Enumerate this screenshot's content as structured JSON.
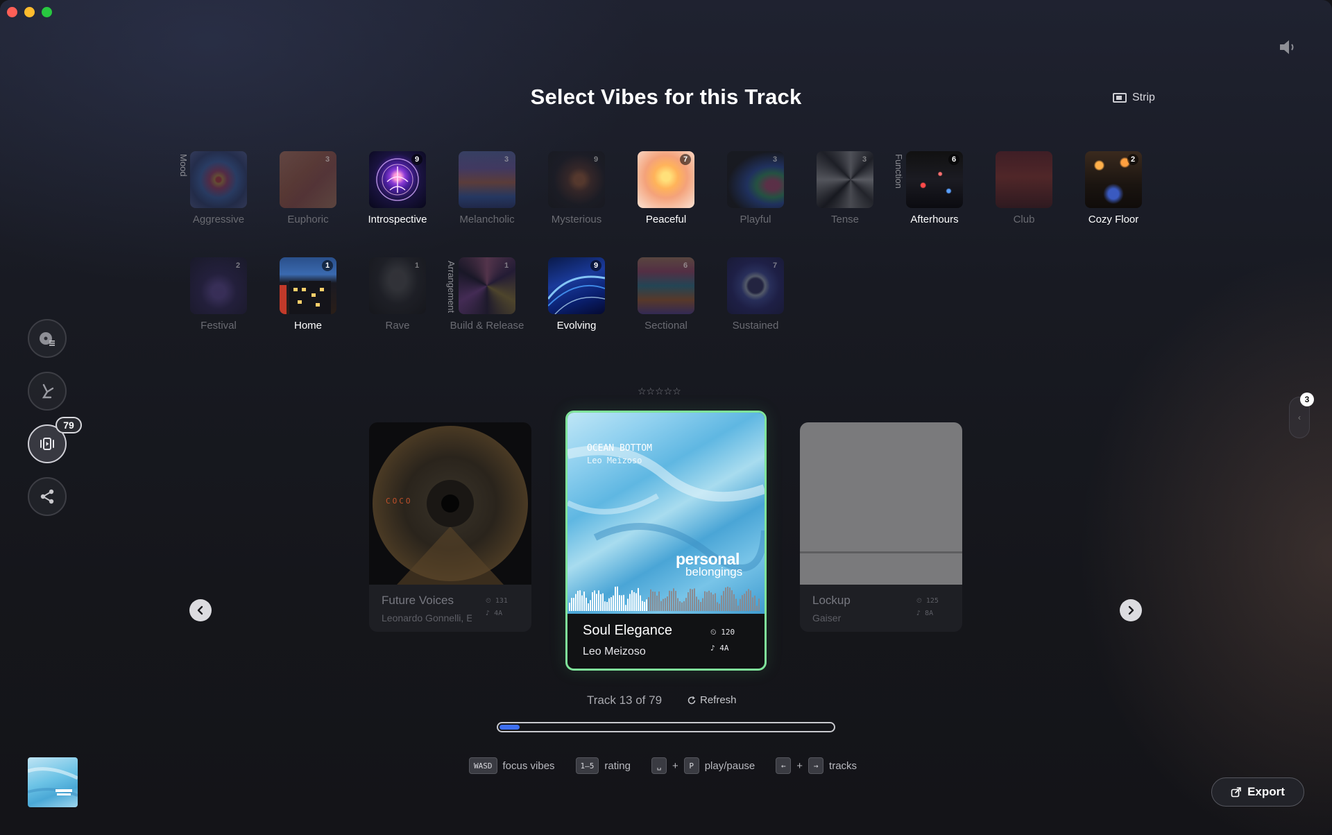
{
  "window": {
    "title": "Select Vibes for this Track"
  },
  "header": {
    "strip_label": "Strip"
  },
  "groups": {
    "mood": "Mood",
    "function": "Function",
    "arrangement": "Arrangement"
  },
  "vibes": [
    {
      "label": "Aggressive",
      "count": "",
      "active": false
    },
    {
      "label": "Euphoric",
      "count": "3",
      "active": false
    },
    {
      "label": "Introspective",
      "count": "9",
      "active": true
    },
    {
      "label": "Melancholic",
      "count": "3",
      "active": false
    },
    {
      "label": "Mysterious",
      "count": "9",
      "active": false
    },
    {
      "label": "Peaceful",
      "count": "7",
      "active": true
    },
    {
      "label": "Playful",
      "count": "3",
      "active": false
    },
    {
      "label": "Tense",
      "count": "3",
      "active": false
    },
    {
      "label": "Afterhours",
      "count": "6",
      "active": true
    },
    {
      "label": "Club",
      "count": "",
      "active": false
    },
    {
      "label": "Cozy Floor",
      "count": "2",
      "active": true
    },
    {
      "label": "Festival",
      "count": "2",
      "active": false
    },
    {
      "label": "Home",
      "count": "1",
      "active": true
    },
    {
      "label": "Rave",
      "count": "1",
      "active": false
    },
    {
      "label": "Build & Release",
      "count": "1",
      "active": false
    },
    {
      "label": "Evolving",
      "count": "9",
      "active": true
    },
    {
      "label": "Sectional",
      "count": "6",
      "active": false
    },
    {
      "label": "Sustained",
      "count": "7",
      "active": false
    }
  ],
  "rating": {
    "stars": "☆☆☆☆☆",
    "value": 0
  },
  "sidebar": {
    "queue_badge": "79"
  },
  "cards": {
    "prev": {
      "title": "Future Voices",
      "artist": "Leonardo Gonnelli, E",
      "bpm": "131",
      "key": "4A",
      "disc_text": "COCO"
    },
    "current": {
      "title": "Soul Elegance",
      "artist": "Leo Meizoso",
      "bpm": "120",
      "key": "4A",
      "art_title": "OCEAN BOTTOM",
      "art_artist": "Leo Meizoso",
      "art_label_1": "personal",
      "art_label_2": "belongings"
    },
    "next": {
      "title": "Lockup",
      "artist": "Gaiser",
      "bpm": "125",
      "key": "8A"
    }
  },
  "side_panel": {
    "badge": "3",
    "arrow": "‹"
  },
  "footer": {
    "track_info": "Track 13 of 79",
    "refresh_label": "Refresh",
    "progress": 0.06,
    "shortcuts": {
      "wasd": "WASD",
      "focus": "focus vibes",
      "digits": "1–5",
      "rating": "rating",
      "space": "␣",
      "plus1": "+",
      "p": "P",
      "playpause": "play/pause",
      "left": "←",
      "plus2": "+",
      "right": "→",
      "tracks": "tracks"
    },
    "export_label": "Export"
  },
  "colors": {
    "accent": "#7fe39a",
    "progress": "#3e6ff0"
  }
}
